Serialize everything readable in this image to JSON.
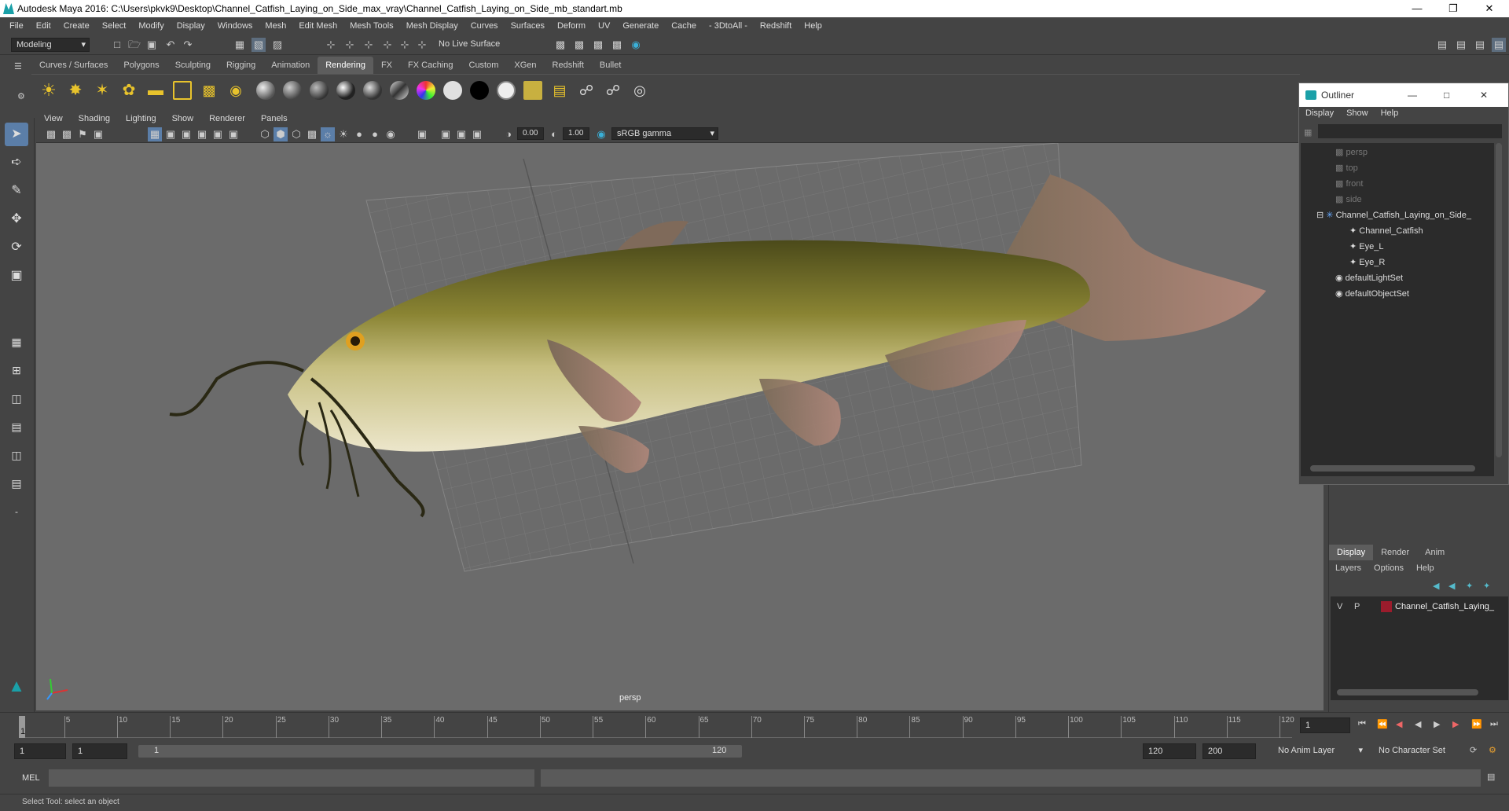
{
  "title": "Autodesk Maya 2016: C:\\Users\\pkvk9\\Desktop\\Channel_Catfish_Laying_on_Side_max_vray\\Channel_Catfish_Laying_on_Side_mb_standart.mb",
  "menu": [
    "File",
    "Edit",
    "Create",
    "Select",
    "Modify",
    "Display",
    "Windows",
    "Mesh",
    "Edit Mesh",
    "Mesh Tools",
    "Mesh Display",
    "Curves",
    "Surfaces",
    "Deform",
    "UV",
    "Generate",
    "Cache",
    "- 3DtoAll -",
    "Redshift",
    "Help"
  ],
  "status": {
    "mode": "Modeling",
    "live_surface": "No Live Surface"
  },
  "shelf_tabs": [
    "Curves / Surfaces",
    "Polygons",
    "Sculpting",
    "Rigging",
    "Animation",
    "Rendering",
    "FX",
    "FX Caching",
    "Custom",
    "XGen",
    "Redshift",
    "Bullet"
  ],
  "active_shelf_tab": "Rendering",
  "panel_menu": [
    "View",
    "Shading",
    "Lighting",
    "Show",
    "Renderer",
    "Panels"
  ],
  "panel_toolbar": {
    "exposure": "0.00",
    "gamma": "1.00",
    "color_space": "sRGB gamma"
  },
  "viewport": {
    "camera_label": "persp"
  },
  "outliner": {
    "title": "Outliner",
    "menu": [
      "Display",
      "Show",
      "Help"
    ],
    "items": [
      {
        "label": "persp",
        "dim": true
      },
      {
        "label": "top",
        "dim": true
      },
      {
        "label": "front",
        "dim": true
      },
      {
        "label": "side",
        "dim": true
      },
      {
        "label": "Channel_Catfish_Laying_on_Side_"
      },
      {
        "label": "Channel_Catfish"
      },
      {
        "label": "Eye_L"
      },
      {
        "label": "Eye_R"
      },
      {
        "label": "defaultLightSet"
      },
      {
        "label": "defaultObjectSet"
      }
    ]
  },
  "channel_box": {
    "tabs": [
      "Display",
      "Render",
      "Anim"
    ],
    "active_tab": "Display",
    "menu": [
      "Layers",
      "Options",
      "Help"
    ],
    "layer": {
      "v": "V",
      "p": "P",
      "name": "Channel_Catfish_Laying_",
      "color": "#9b1c2c"
    }
  },
  "timeline": {
    "ticks": [
      "5",
      "10",
      "15",
      "20",
      "25",
      "30",
      "35",
      "40",
      "45",
      "50",
      "55",
      "60",
      "65",
      "70",
      "75",
      "80",
      "85",
      "90",
      "95",
      "100",
      "105",
      "110",
      "115",
      "120"
    ],
    "start_marker": "1",
    "current_frame": "1",
    "range_end": 120
  },
  "range": {
    "start": "1",
    "anim_start": "1",
    "slider_start": "1",
    "slider_end": "120",
    "anim_end": "120",
    "end": "200",
    "anim_layer": "No Anim Layer",
    "char_set": "No Character Set"
  },
  "command": {
    "label": "MEL"
  },
  "help_line": "Select Tool: select an object",
  "colors": {
    "accent": "#5d5d5d",
    "viewport_bg": "#6b6b6b",
    "fish_back": "#6b6a2a",
    "fish_belly": "#e8e3c8"
  }
}
